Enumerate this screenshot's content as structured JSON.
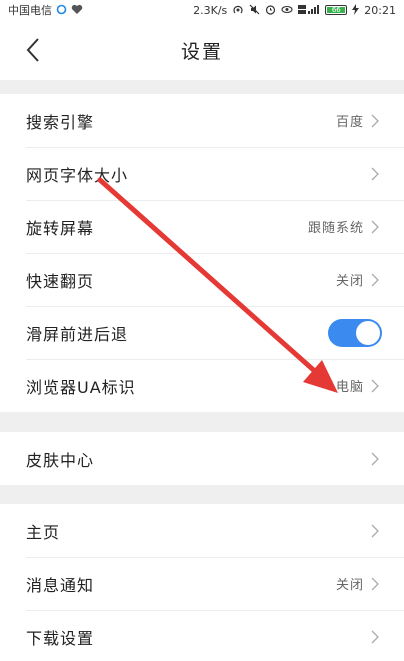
{
  "status_bar": {
    "carrier": "中国电信",
    "speed": "2.3K/s",
    "time": "20:21",
    "battery_text": "66"
  },
  "header": {
    "title": "设置"
  },
  "groups": [
    {
      "items": [
        {
          "label": "搜索引擎",
          "value": "百度",
          "chevron": true
        },
        {
          "label": "网页字体大小",
          "value": "",
          "chevron": true
        },
        {
          "label": "旋转屏幕",
          "value": "跟随系统",
          "chevron": true
        },
        {
          "label": "快速翻页",
          "value": "关闭",
          "chevron": true
        },
        {
          "label": "滑屏前进后退",
          "toggle": true,
          "toggle_on": true
        },
        {
          "label": "浏览器UA标识",
          "value": "电脑",
          "chevron": true
        }
      ]
    },
    {
      "items": [
        {
          "label": "皮肤中心",
          "value": "",
          "chevron": true
        }
      ]
    },
    {
      "items": [
        {
          "label": "主页",
          "value": "",
          "chevron": true
        },
        {
          "label": "消息通知",
          "value": "关闭",
          "chevron": true
        },
        {
          "label": "下载设置",
          "value": "",
          "chevron": true
        }
      ]
    }
  ],
  "colors": {
    "accent": "#3b8af0",
    "annotation_arrow": "#e53935"
  }
}
